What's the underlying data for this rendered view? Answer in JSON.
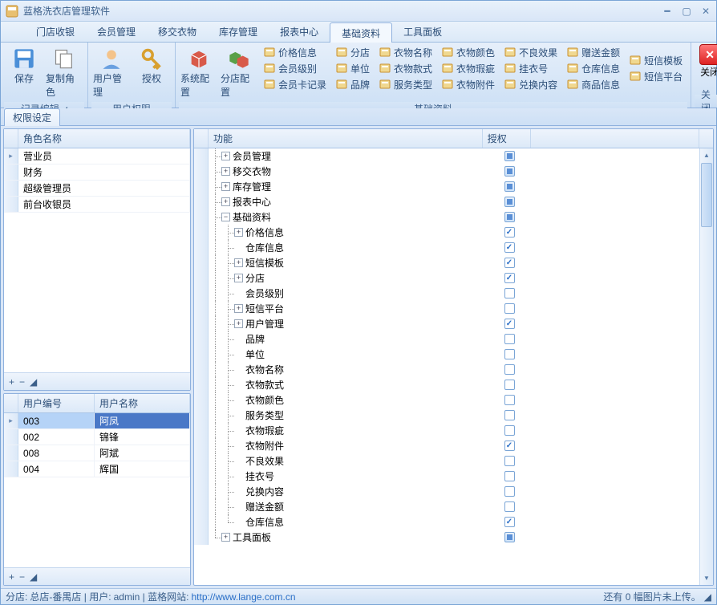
{
  "app": {
    "title": "蓝格洗衣店管理软件"
  },
  "menu": {
    "items": [
      "门店收银",
      "会员管理",
      "移交衣物",
      "库存管理",
      "报表中心",
      "基础资料",
      "工具面板"
    ],
    "active_index": 5
  },
  "ribbon": {
    "groups": {
      "record_edit": {
        "label": "记录编辑",
        "save": "保存",
        "copy_role": "复制角色"
      },
      "user_perm": {
        "label": "用户权限",
        "user_mgmt": "用户管理",
        "auth": "授权"
      },
      "base_data": {
        "label": "基础资料",
        "sys_config": "系统配置",
        "store_config": "分店配置",
        "cols": [
          [
            "价格信息",
            "会员级别",
            "会员卡记录"
          ],
          [
            "分店",
            "单位",
            "品牌"
          ],
          [
            "衣物名称",
            "衣物款式",
            "服务类型"
          ],
          [
            "衣物颜色",
            "衣物瑕疵",
            "衣物附件"
          ],
          [
            "不良效果",
            "挂衣号",
            "兑换内容"
          ],
          [
            "赠送金额",
            "仓库信息",
            "商品信息"
          ],
          [
            "短信模板",
            "短信平台"
          ]
        ]
      },
      "close": {
        "label": "关闭",
        "btn": "关闭"
      }
    }
  },
  "tab": {
    "label": "权限设定"
  },
  "roles": {
    "header": "角色名称",
    "rows": [
      "营业员",
      "财务",
      "超级管理员",
      "前台收银员"
    ],
    "selected": 0
  },
  "users": {
    "headers": {
      "id": "用户编号",
      "name": "用户名称"
    },
    "rows": [
      {
        "id": "003",
        "name": "阿凤"
      },
      {
        "id": "002",
        "name": "锦锋"
      },
      {
        "id": "008",
        "name": "阿斌"
      },
      {
        "id": "004",
        "name": "辉国"
      }
    ],
    "selected": 0
  },
  "tree": {
    "headers": {
      "func": "功能",
      "auth": "授权"
    },
    "nodes": [
      {
        "label": "会员管理",
        "depth": 0,
        "exp": "+",
        "state": "tri",
        "last": false
      },
      {
        "label": "移交衣物",
        "depth": 0,
        "exp": "+",
        "state": "tri",
        "last": false
      },
      {
        "label": "库存管理",
        "depth": 0,
        "exp": "+",
        "state": "tri",
        "last": false
      },
      {
        "label": "报表中心",
        "depth": 0,
        "exp": "+",
        "state": "tri",
        "last": false
      },
      {
        "label": "基础资料",
        "depth": 0,
        "exp": "-",
        "state": "tri",
        "last": false
      },
      {
        "label": "价格信息",
        "depth": 1,
        "exp": "+",
        "state": "checked",
        "last": false,
        "pguides": [
          true
        ]
      },
      {
        "label": "仓库信息",
        "depth": 1,
        "exp": "",
        "state": "checked",
        "last": false,
        "pguides": [
          true
        ]
      },
      {
        "label": "短信模板",
        "depth": 1,
        "exp": "+",
        "state": "checked",
        "last": false,
        "pguides": [
          true
        ]
      },
      {
        "label": "分店",
        "depth": 1,
        "exp": "+",
        "state": "checked",
        "last": false,
        "pguides": [
          true
        ]
      },
      {
        "label": "会员级别",
        "depth": 1,
        "exp": "",
        "state": "",
        "last": false,
        "pguides": [
          true
        ]
      },
      {
        "label": "短信平台",
        "depth": 1,
        "exp": "+",
        "state": "",
        "last": false,
        "pguides": [
          true
        ]
      },
      {
        "label": "用户管理",
        "depth": 1,
        "exp": "+",
        "state": "checked",
        "last": false,
        "pguides": [
          true
        ]
      },
      {
        "label": "品牌",
        "depth": 1,
        "exp": "",
        "state": "",
        "last": false,
        "pguides": [
          true
        ]
      },
      {
        "label": "单位",
        "depth": 1,
        "exp": "",
        "state": "",
        "last": false,
        "pguides": [
          true
        ]
      },
      {
        "label": "衣物名称",
        "depth": 1,
        "exp": "",
        "state": "",
        "last": false,
        "pguides": [
          true
        ]
      },
      {
        "label": "衣物款式",
        "depth": 1,
        "exp": "",
        "state": "",
        "last": false,
        "pguides": [
          true
        ]
      },
      {
        "label": "衣物颜色",
        "depth": 1,
        "exp": "",
        "state": "",
        "last": false,
        "pguides": [
          true
        ]
      },
      {
        "label": "服务类型",
        "depth": 1,
        "exp": "",
        "state": "",
        "last": false,
        "pguides": [
          true
        ]
      },
      {
        "label": "衣物瑕疵",
        "depth": 1,
        "exp": "",
        "state": "",
        "last": false,
        "pguides": [
          true
        ]
      },
      {
        "label": "衣物附件",
        "depth": 1,
        "exp": "",
        "state": "checked",
        "last": false,
        "pguides": [
          true
        ]
      },
      {
        "label": "不良效果",
        "depth": 1,
        "exp": "",
        "state": "",
        "last": false,
        "pguides": [
          true
        ]
      },
      {
        "label": "挂衣号",
        "depth": 1,
        "exp": "",
        "state": "",
        "last": false,
        "pguides": [
          true
        ]
      },
      {
        "label": "兑换内容",
        "depth": 1,
        "exp": "",
        "state": "",
        "last": false,
        "pguides": [
          true
        ]
      },
      {
        "label": "赠送金额",
        "depth": 1,
        "exp": "",
        "state": "",
        "last": false,
        "pguides": [
          true
        ]
      },
      {
        "label": "仓库信息",
        "depth": 1,
        "exp": "",
        "state": "checked",
        "last": true,
        "pguides": [
          true
        ]
      },
      {
        "label": "工具面板",
        "depth": 0,
        "exp": "+",
        "state": "tri",
        "last": true
      }
    ]
  },
  "status": {
    "store_label": "分店:",
    "store": "总店-番禺店",
    "user_label": "用户:",
    "user": "admin",
    "site_label": "蓝格网站:",
    "site_url": "http://www.lange.com.cn",
    "upload_hint": "还有 0 幅图片未上传。"
  }
}
